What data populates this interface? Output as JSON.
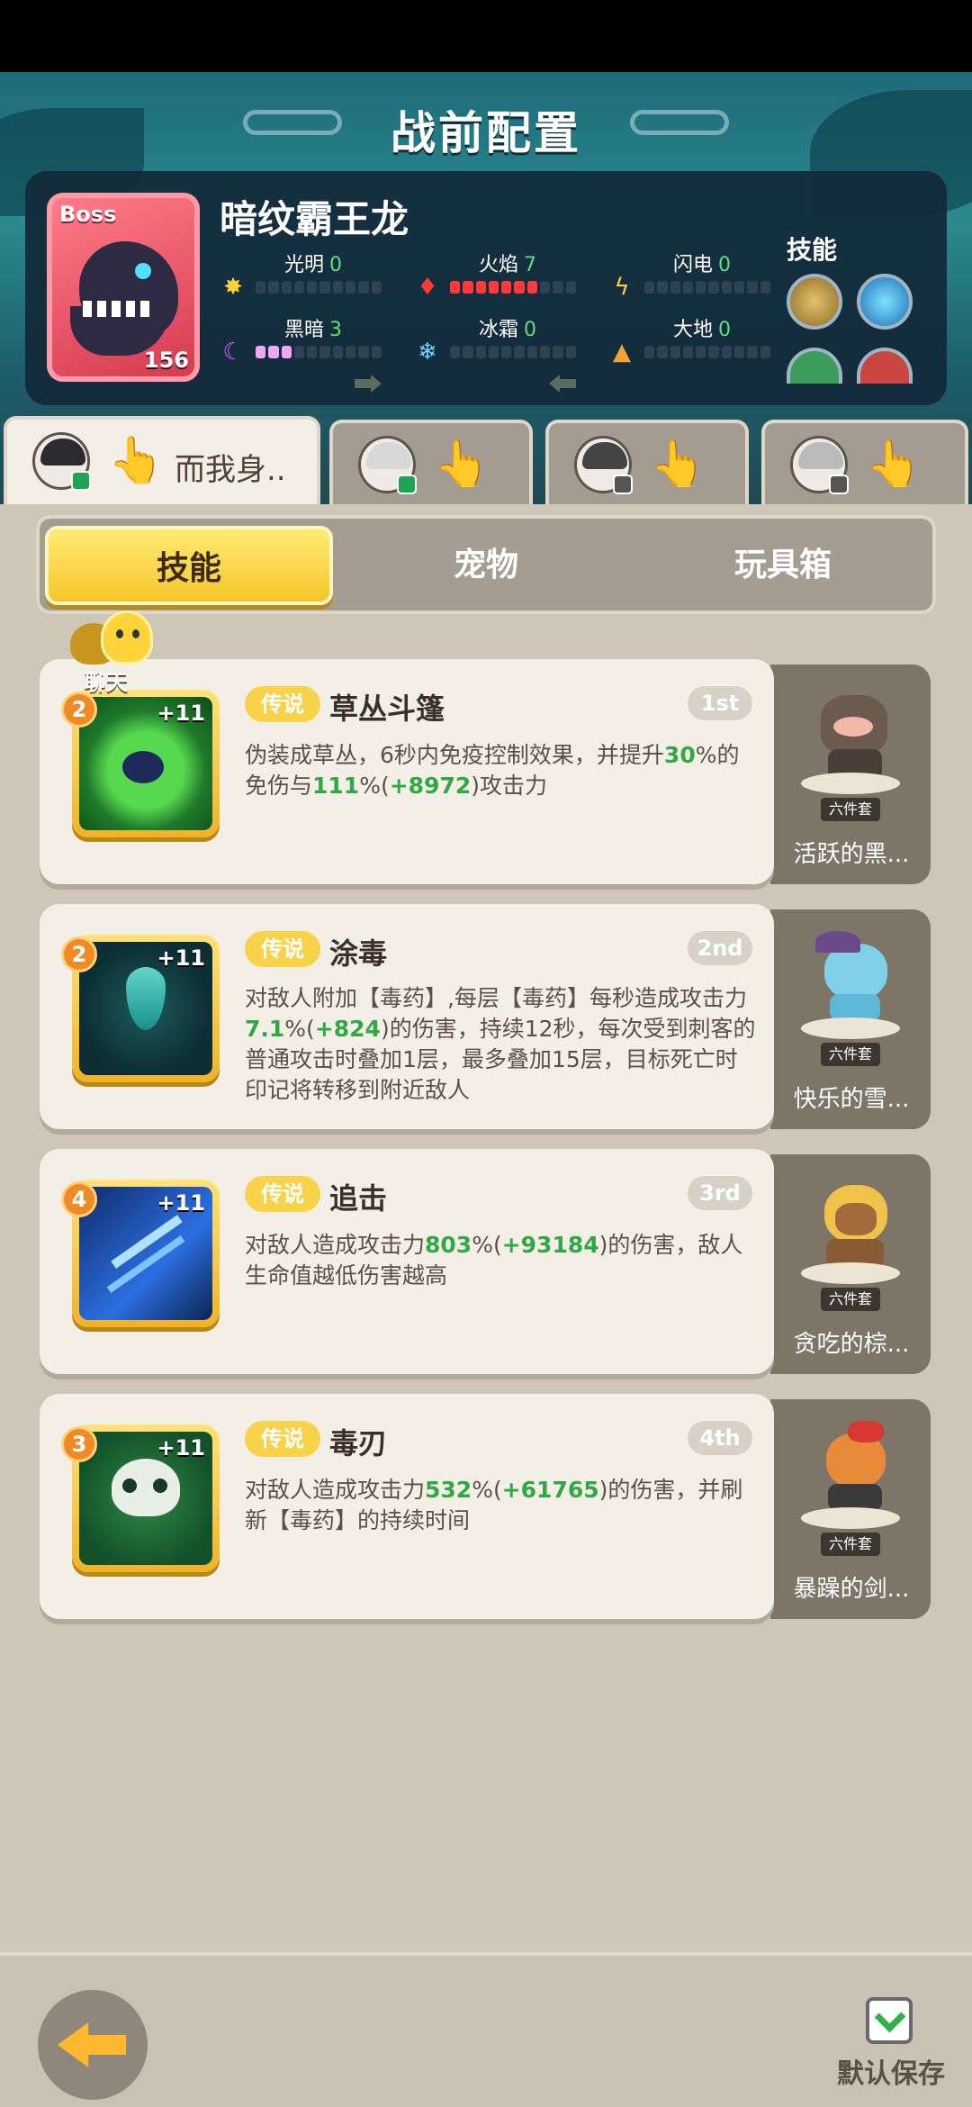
{
  "page_title": "战前配置",
  "boss": {
    "tag": "Boss",
    "name": "暗纹霸王龙",
    "level": "156",
    "skills_label": "技能",
    "stats": [
      {
        "label": "光明",
        "value": "0",
        "icon": "sun-icon"
      },
      {
        "label": "火焰",
        "value": "7",
        "icon": "flame-icon"
      },
      {
        "label": "闪电",
        "value": "0",
        "icon": "lightning-icon"
      },
      {
        "label": "黑暗",
        "value": "3",
        "icon": "moon-icon"
      },
      {
        "label": "冰霜",
        "value": "0",
        "icon": "snowflake-icon"
      },
      {
        "label": "大地",
        "value": "0",
        "icon": "earth-icon"
      }
    ]
  },
  "character_tabs": [
    {
      "name": "而我身.."
    },
    {
      "name": ""
    },
    {
      "name": ""
    },
    {
      "name": ""
    }
  ],
  "segment_tabs": {
    "skills": "技能",
    "pets": "宠物",
    "toybox": "玩具箱"
  },
  "chat": {
    "label": "聊天"
  },
  "skills": [
    {
      "level": "2",
      "plus": "+11",
      "badge": "传说",
      "name": "草丛斗篷",
      "rank": "1st",
      "pet_set": "六件套",
      "pet_name": "活跃的黑..."
    },
    {
      "level": "2",
      "plus": "+11",
      "badge": "传说",
      "name": "涂毒",
      "rank": "2nd",
      "pet_set": "六件套",
      "pet_name": "快乐的雪..."
    },
    {
      "level": "4",
      "plus": "+11",
      "badge": "传说",
      "name": "追击",
      "rank": "3rd",
      "pet_set": "六件套",
      "pet_name": "贪吃的棕..."
    },
    {
      "level": "3",
      "plus": "+11",
      "badge": "传说",
      "name": "毒刃",
      "rank": "4th",
      "pet_set": "六件套",
      "pet_name": "暴躁的剑..."
    }
  ],
  "desc_1": {
    "a": "伪装成草丛，6秒内免疫控制效果，并提升",
    "b": "30",
    "c": "%的免伤与",
    "d": "111",
    "e": "%(",
    "f": "+8972",
    "g": ")攻击力"
  },
  "desc_2": {
    "a": "对敌人附加【毒药】,每层【毒药】每秒造成攻击力",
    "b": "7.1",
    "c": "%(",
    "d": "+824",
    "e": ")的伤害，持续12秒，每次受到刺客的普通攻击时叠加1层，最多叠加15层，目标死亡时印记将转移到附近敌人"
  },
  "desc_3": {
    "a": "对敌人造成攻击力",
    "b": "803",
    "c": "%(",
    "d": "+93184",
    "e": ")的伤害，敌人生命值越低伤害越高"
  },
  "desc_4": {
    "a": "对敌人造成攻击力",
    "b": "532",
    "c": "%(",
    "d": "+61765",
    "e": ")的伤害，并刷新【毒药】的持续时间"
  },
  "bottom": {
    "save_label": "默认保存"
  }
}
